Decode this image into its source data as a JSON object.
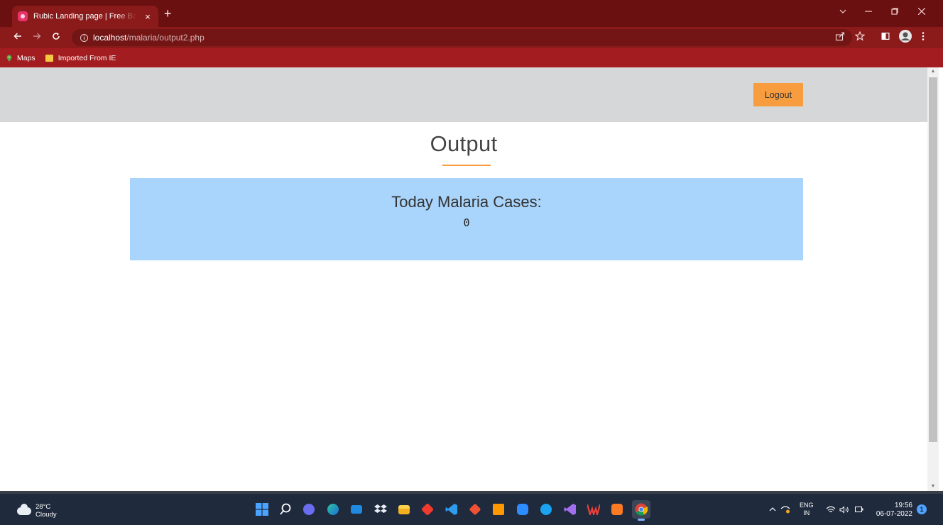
{
  "browser": {
    "tab_title": "Rubic Landing page | Free Bootstrap",
    "tab_close": "×",
    "new_tab": "+",
    "url_host": "localhost",
    "url_path": "/malaria/output2.php",
    "bookmarks": [
      {
        "label": "Maps",
        "icon": "maps-pin-icon"
      },
      {
        "label": "Imported From IE",
        "icon": "folder-icon"
      }
    ]
  },
  "page": {
    "logout_label": "Logout",
    "section_title": "Output",
    "result_label": "Today Malaria Cases:",
    "result_value": "0",
    "accent_color": "#f89d3f",
    "result_bg": "#a9d4fb"
  },
  "taskbar": {
    "weather_temp": "28°C",
    "weather_desc": "Cloudy",
    "lang_top": "ENG",
    "lang_bottom": "IN",
    "time": "19:56",
    "date": "06-07-2022",
    "notification_count": "1",
    "apps": [
      "windows-start-icon",
      "search-icon",
      "chat-icon",
      "edge-icon",
      "mail-icon",
      "dropbox-icon",
      "file-explorer-icon",
      "app-red-diamond-icon",
      "vscode-icon",
      "git-icon",
      "sublime-icon",
      "zoom-icon",
      "skype-icon",
      "visual-studio-icon",
      "wps-icon",
      "xampp-icon",
      "chrome-icon"
    ]
  }
}
